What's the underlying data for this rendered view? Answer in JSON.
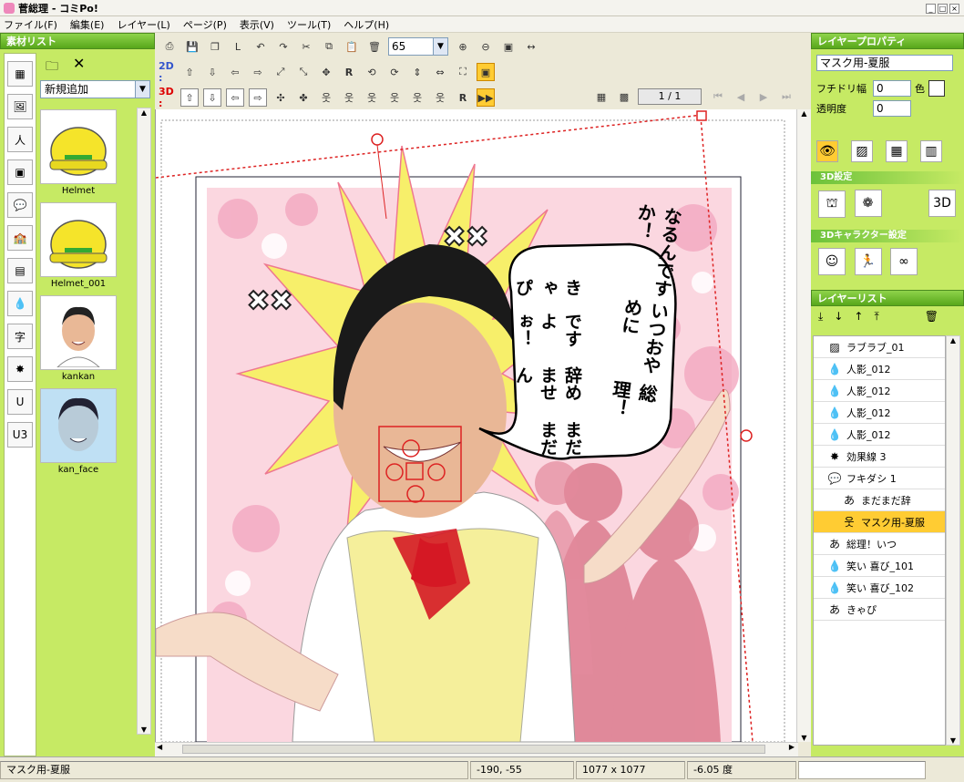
{
  "app": {
    "title": "菅総理 - コミPo!"
  },
  "menu": [
    "ファイル(F)",
    "編集(E)",
    "レイヤー(L)",
    "ページ(P)",
    "表示(V)",
    "ツール(T)",
    "ヘルプ(H)"
  ],
  "material_panel": {
    "header": "素材リスト",
    "dropdown_value": "新規追加",
    "items": [
      {
        "label": "Helmet",
        "icon": "helmet-icon"
      },
      {
        "label": "Helmet_001",
        "icon": "helmet-icon"
      },
      {
        "label": "kankan",
        "icon": "character-face-icon"
      },
      {
        "label": "kan_face",
        "icon": "character-face-icon"
      }
    ]
  },
  "toolbar": {
    "zoom_value": "65",
    "row2d_label": "2D :",
    "row3d_label": "3D :",
    "page_indicator": "1 / 1"
  },
  "comic": {
    "bubble_small_lines": [
      "まだまだ",
      "辞めません",
      "ですよぉ！",
      "きゃぴ"
    ],
    "bubble_main_lines": [
      "総理！",
      "いつおやめに",
      "なるんですか！"
    ]
  },
  "layer_props": {
    "header": "レイヤープロパティ",
    "layer_name": "マスク用-夏服",
    "border_width_label": "フチドリ幅",
    "border_width_value": "0",
    "color_label": "色",
    "opacity_label": "透明度",
    "opacity_value": "0",
    "section_3d": "3D設定",
    "section_3dchar": "3Dキャラクター設定"
  },
  "layer_list": {
    "header": "レイヤーリスト",
    "items": [
      {
        "label": "ラブラブ_01",
        "icon": "image-icon",
        "selected": false,
        "indent": 0
      },
      {
        "label": "人影_012",
        "icon": "drop-icon",
        "selected": false,
        "indent": 0
      },
      {
        "label": "人影_012",
        "icon": "drop-icon",
        "selected": false,
        "indent": 0
      },
      {
        "label": "人影_012",
        "icon": "drop-icon",
        "selected": false,
        "indent": 0
      },
      {
        "label": "人影_012",
        "icon": "drop-icon",
        "selected": false,
        "indent": 0
      },
      {
        "label": "効果線 3",
        "icon": "effect-lines-icon",
        "selected": false,
        "indent": 0
      },
      {
        "label": "フキダシ 1",
        "icon": "speech-bubble-icon",
        "selected": false,
        "indent": 0
      },
      {
        "label": "まだまだ辞",
        "icon": "text-a-icon",
        "selected": false,
        "indent": 1
      },
      {
        "label": "マスク用-夏服",
        "icon": "character-icon",
        "selected": true,
        "indent": 1
      },
      {
        "label": "総理！いつ",
        "icon": "text-a-icon",
        "selected": false,
        "indent": 0
      },
      {
        "label": "笑い 喜び_101",
        "icon": "drop-icon",
        "selected": false,
        "indent": 0
      },
      {
        "label": "笑い 喜び_102",
        "icon": "drop-icon",
        "selected": false,
        "indent": 0
      },
      {
        "label": "きゃぴ",
        "icon": "text-a-icon",
        "selected": false,
        "indent": 0
      }
    ]
  },
  "status": {
    "layer_name": "マスク用-夏服",
    "coords": "-190, -55",
    "size": "1077 x 1077",
    "angle": "-6.05 度"
  },
  "colors": {
    "panel_green": "#c6ea64",
    "header_green": "#57a71a",
    "selection": "#ffcc33",
    "red_3d": "#dd0000",
    "blue_2d": "#3355cc"
  }
}
